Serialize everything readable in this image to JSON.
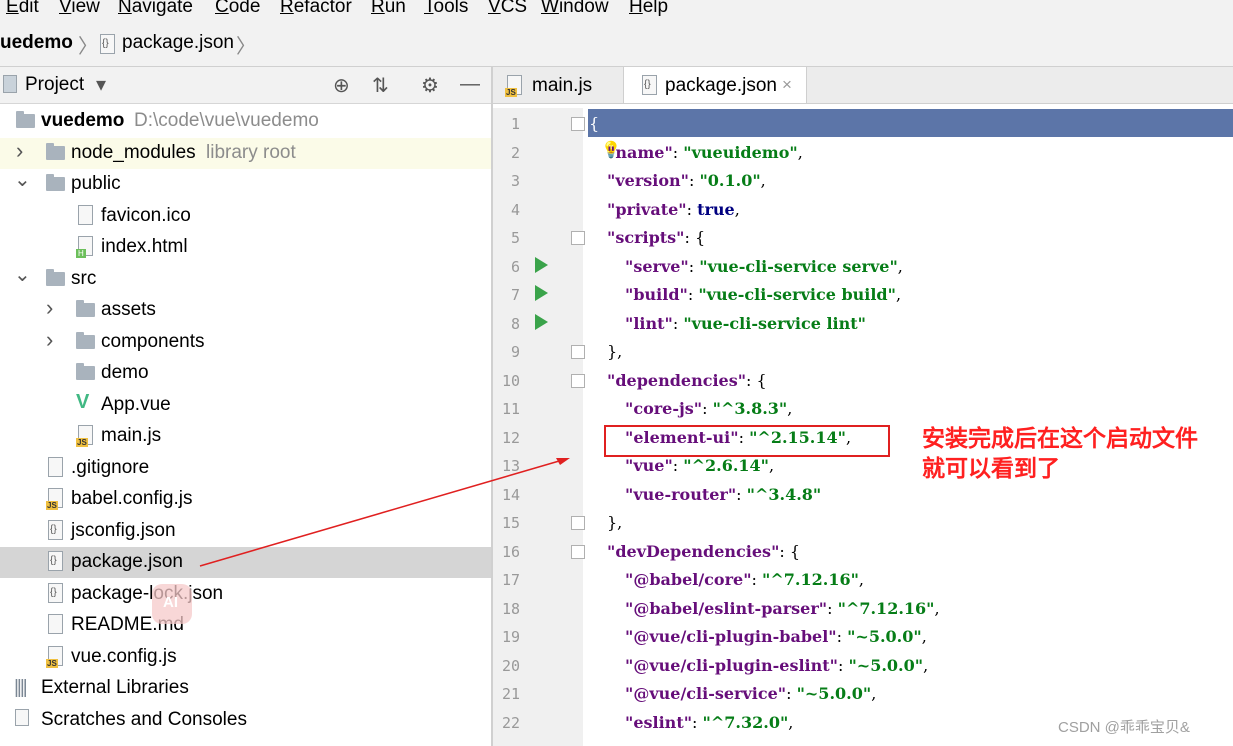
{
  "menu": [
    "Edit",
    "View",
    "Navigate",
    "Code",
    "Refactor",
    "Run",
    "Tools",
    "VCS",
    "Window",
    "Help"
  ],
  "menu_underline": [
    "E",
    "V",
    "N",
    "C",
    "R",
    "R",
    "T",
    "V",
    "W",
    "H"
  ],
  "menu_rest": [
    "dit",
    "iew",
    "avigate",
    "ode",
    "efactor",
    "un",
    "ools",
    "CS",
    "indow",
    "elp"
  ],
  "breadcrumb": {
    "project": "uedemo",
    "file": "package.json",
    "sep": "〉"
  },
  "project_panel": {
    "title": "Project",
    "dropdown": "▾",
    "icons": {
      "locate": "⊕",
      "collapse": "⇅",
      "settings": "⚙",
      "hide": "—"
    }
  },
  "tree": [
    {
      "label": "vuedemo",
      "extra": "D:\\code\\vue\\vuedemo"
    },
    {
      "label": "node_modules",
      "extra": "library root",
      "arrow": "›"
    },
    {
      "label": "public",
      "arrow": "⌄"
    },
    {
      "label": "favicon.ico"
    },
    {
      "label": "index.html"
    },
    {
      "label": "src",
      "arrow": "⌄"
    },
    {
      "label": "assets",
      "arrow": "›"
    },
    {
      "label": "components",
      "arrow": "›"
    },
    {
      "label": "demo"
    },
    {
      "label": "App.vue"
    },
    {
      "label": "main.js"
    },
    {
      "label": ".gitignore"
    },
    {
      "label": "babel.config.js"
    },
    {
      "label": "jsconfig.json"
    },
    {
      "label": "package.json"
    },
    {
      "label": "package-lock.json"
    },
    {
      "label": "README.md"
    },
    {
      "label": "vue.config.js"
    },
    {
      "label": "External Libraries"
    },
    {
      "label": "Scratches and Consoles"
    }
  ],
  "tabs": [
    {
      "label": "main.js"
    },
    {
      "label": "package.json",
      "close": "×"
    }
  ],
  "line_numbers": [
    "1",
    "2",
    "3",
    "4",
    "5",
    "6",
    "7",
    "8",
    "9",
    "10",
    "11",
    "12",
    "13",
    "14",
    "15",
    "16",
    "17",
    "18",
    "19",
    "20",
    "21",
    "22"
  ],
  "code": {
    "l1": "{",
    "l2k": "\"name\"",
    "l2v": "\"vueuidemo\"",
    "l3k": "\"version\"",
    "l3v": "\"0.1.0\"",
    "l4k": "\"private\"",
    "l4v": "true",
    "l5k": "\"scripts\"",
    "l5v": "{",
    "l6k": "\"serve\"",
    "l6v": "\"vue-cli-service serve\"",
    "l7k": "\"build\"",
    "l7v": "\"vue-cli-service build\"",
    "l8k": "\"lint\"",
    "l8v": "\"vue-cli-service lint\"",
    "l9": "},",
    "l10k": "\"dependencies\"",
    "l10v": "{",
    "l11k": "\"core-js\"",
    "l11v": "\"^3.8.3\"",
    "l12k": "\"element-ui\"",
    "l12v": "\"^2.15.14\"",
    "l13k": "\"vue\"",
    "l13v": "\"^2.6.14\"",
    "l14k": "\"vue-router\"",
    "l14v": "\"^3.4.8\"",
    "l15": "},",
    "l16k": "\"devDependencies\"",
    "l16v": "{",
    "l17k": "\"@babel/core\"",
    "l17v": "\"^7.12.16\"",
    "l18k": "\"@babel/eslint-parser\"",
    "l18v": "\"^7.12.16\"",
    "l19k": "\"@vue/cli-plugin-babel\"",
    "l19v": "\"~5.0.0\"",
    "l20k": "\"@vue/cli-plugin-eslint\"",
    "l20v": "\"~5.0.0\"",
    "l21k": "\"@vue/cli-service\"",
    "l21v": "\"~5.0.0\"",
    "l22k": "\"eslint\"",
    "l22v": "\"^7.32.0\""
  },
  "annotation": {
    "line1": "安装完成后在这个启动文件",
    "line2": "就可以看到了"
  },
  "watermark": "CSDN @乖乖宝贝&",
  "badge_ai": "AI",
  "colors": {
    "selection": "#5c75a8",
    "key": "#660e7a",
    "string": "#067d17",
    "annotation": "#ff2020"
  }
}
